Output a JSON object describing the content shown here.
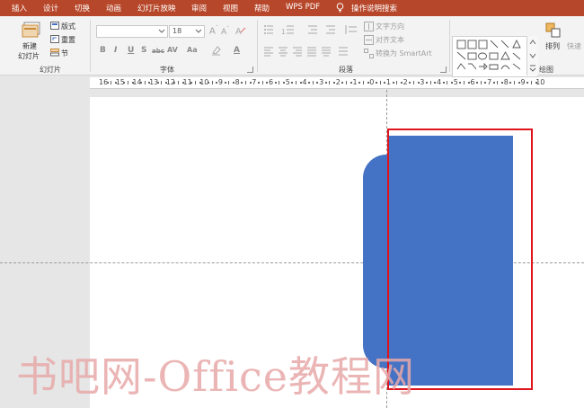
{
  "tabs": [
    "插入",
    "设计",
    "切换",
    "动画",
    "幻灯片放映",
    "审阅",
    "视图",
    "帮助",
    "WPS PDF",
    "操作说明搜索"
  ],
  "ribbon": {
    "slides": {
      "new_slide": "新建",
      "new_slide_2": "幻灯片",
      "layout": "版式",
      "reset": "重置",
      "section": "节",
      "group_label": "幻灯片"
    },
    "font": {
      "font_name": "",
      "font_size": "18",
      "group_label": "字体",
      "buttons": [
        "B",
        "I",
        "U",
        "S",
        "abc",
        "AV",
        "Aa",
        "A"
      ]
    },
    "paragraph": {
      "text_direction": "文字方向",
      "align_text": "对齐文本",
      "convert_smartart": "转换为 SmartArt",
      "group_label": "段落"
    },
    "drawing": {
      "arrange": "排列",
      "quick_styles": "快速",
      "group_label": "绘图"
    }
  },
  "ruler": {
    "labels": [
      "16",
      "15",
      "14",
      "13",
      "12",
      "11",
      "10",
      "9",
      "8",
      "7",
      "6",
      "5",
      "4",
      "3",
      "2",
      "1",
      "0",
      "1",
      "2",
      "3",
      "4",
      "5",
      "6",
      "7",
      "8",
      "9",
      "10"
    ]
  },
  "watermark": "书吧网-Office教程网",
  "colors": {
    "tab_bar": "#b7472a",
    "shape_fill": "#4472c4",
    "selection": "#e0141c"
  }
}
